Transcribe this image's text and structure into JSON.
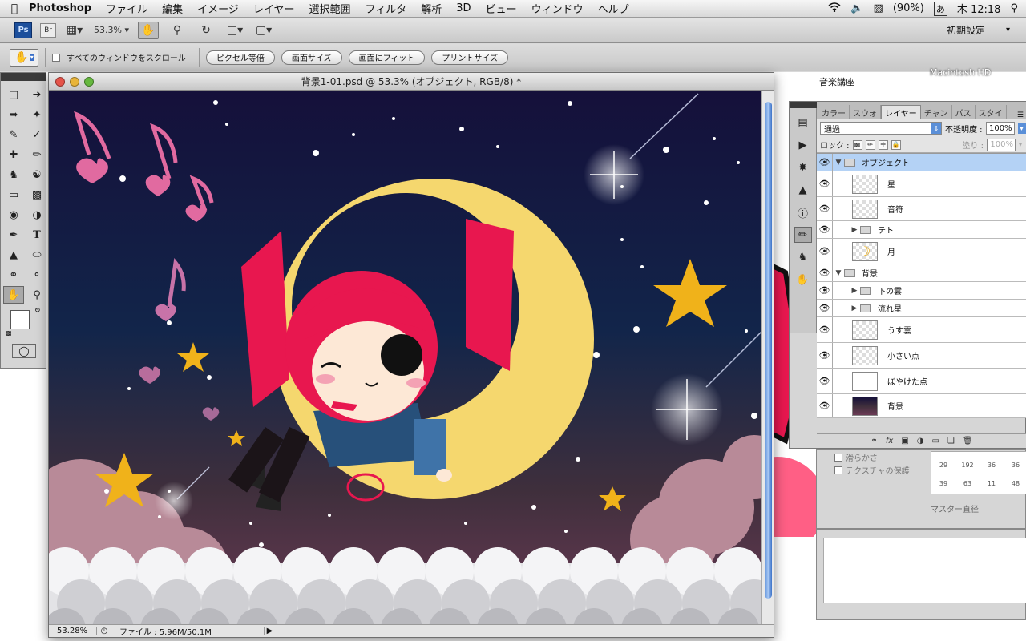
{
  "menubar": {
    "app": "Photoshop",
    "items": [
      "ファイル",
      "編集",
      "イメージ",
      "レイヤー",
      "選択範囲",
      "フィルタ",
      "解析",
      "3D",
      "ビュー",
      "ウィンドウ",
      "ヘルプ"
    ],
    "battery": "(90%)",
    "input_method": "あ",
    "clock": "木 12:18"
  },
  "appbar": {
    "ps": "Ps",
    "br": "Br",
    "zoom": "53.3%",
    "workspace": "初期設定"
  },
  "options": {
    "scroll_all_label": "すべてのウィンドウをスクロール",
    "buttons": [
      "ピクセル等倍",
      "画面サイズ",
      "画面にフィット",
      "プリントサイズ"
    ]
  },
  "document": {
    "title": "背景1-01.psd @ 53.3% (オブジェクト, RGB/8) *",
    "status_zoom": "53.28%",
    "status_file": "ファイル : 5.96M/50.1M"
  },
  "desktop_labels": {
    "music_course": "音楽講座",
    "hd": "Macintosh HD"
  },
  "layers_panel": {
    "tabs": [
      "カラー",
      "スウォ",
      "レイヤー",
      "チャン",
      "パス",
      "スタイ"
    ],
    "blend_mode": "通過",
    "opacity_label": "不透明度 :",
    "opacity": "100%",
    "lock_label": "ロック :",
    "fill_label": "塗り :",
    "fill": "100%",
    "layers": [
      {
        "name": "オブジェクト",
        "type": "group",
        "expanded": true,
        "indent": 0,
        "selected": true
      },
      {
        "name": "星",
        "type": "layer",
        "indent": 1
      },
      {
        "name": "音符",
        "type": "layer",
        "indent": 1
      },
      {
        "name": "テト",
        "type": "group",
        "expanded": false,
        "indent": 1
      },
      {
        "name": "月",
        "type": "layer",
        "indent": 1
      },
      {
        "name": "背景",
        "type": "group",
        "expanded": true,
        "indent": 0
      },
      {
        "name": "下の雲",
        "type": "group",
        "expanded": false,
        "indent": 1
      },
      {
        "name": "流れ星",
        "type": "group",
        "expanded": false,
        "indent": 1
      },
      {
        "name": "うす雲",
        "type": "layer",
        "indent": 1
      },
      {
        "name": "小さい点",
        "type": "layer",
        "indent": 1
      },
      {
        "name": "ぼやけた点",
        "type": "layer",
        "indent": 1
      },
      {
        "name": "背景",
        "type": "layer",
        "indent": 1
      }
    ]
  },
  "brush_panel": {
    "smoothing": "滑らかさ",
    "texture": "テクスチャの保護",
    "master_diameter": "マスター直径",
    "sizes": [
      "29",
      "192",
      "36",
      "36",
      "39",
      "63",
      "11",
      "48"
    ]
  },
  "colors": {
    "accent": "#5a8fd8",
    "selection": "#b4d2f5",
    "moon": "#f5d76e",
    "hair": "#e8174f",
    "star": "#f0b21a",
    "sky_top": "#15103a",
    "sky_bottom": "#6b3a55"
  }
}
